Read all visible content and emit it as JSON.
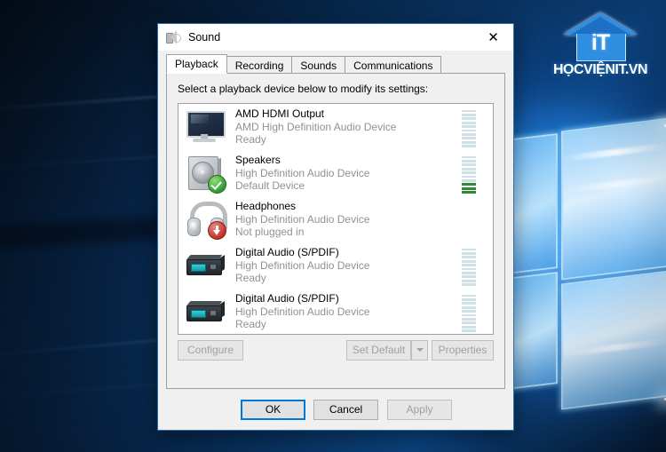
{
  "desktop": {
    "wallpaper_name": "windows-10-hero-wallpaper",
    "watermark": {
      "logo_text": "iT",
      "site_name": "HỌCVIỆNIT.VN",
      "accent": "#2f8ee0"
    }
  },
  "dialog": {
    "title": "Sound",
    "icon": "speaker-icon",
    "close_label": "✕",
    "tabs": [
      {
        "label": "Playback",
        "active": true
      },
      {
        "label": "Recording",
        "active": false
      },
      {
        "label": "Sounds",
        "active": false
      },
      {
        "label": "Communications",
        "active": false
      }
    ],
    "instruction": "Select a playback device below to modify its settings:",
    "devices": [
      {
        "name": "AMD HDMI Output",
        "driver": "AMD High Definition Audio Device",
        "status": "Ready",
        "icon": "monitor-icon",
        "badge": "none",
        "meter_segments": 10,
        "meter_lit": 0,
        "meter_visible": true
      },
      {
        "name": "Speakers",
        "driver": "High Definition Audio Device",
        "status": "Default Device",
        "icon": "speaker-icon",
        "badge": "green-check-icon",
        "meter_segments": 10,
        "meter_lit": 3,
        "meter_visible": true
      },
      {
        "name": "Headphones",
        "driver": "High Definition Audio Device",
        "status": "Not plugged in",
        "icon": "headphones-icon",
        "badge": "red-down-arrow-icon",
        "meter_segments": 10,
        "meter_lit": 0,
        "meter_visible": false
      },
      {
        "name": "Digital Audio (S/PDIF)",
        "driver": "High Definition Audio Device",
        "status": "Ready",
        "icon": "spdif-device-icon",
        "badge": "none",
        "meter_segments": 10,
        "meter_lit": 0,
        "meter_visible": true
      },
      {
        "name": "Digital Audio (S/PDIF)",
        "driver": "High Definition Audio Device",
        "status": "Ready",
        "icon": "spdif-device-icon",
        "badge": "none",
        "meter_segments": 10,
        "meter_lit": 0,
        "meter_visible": true
      }
    ],
    "mid_buttons": {
      "configure": {
        "label": "Configure",
        "enabled": false
      },
      "set_default": {
        "label": "Set Default",
        "enabled": false
      },
      "set_default_arrow": {
        "icon": "chevron-down-icon",
        "enabled": false
      },
      "properties": {
        "label": "Properties",
        "enabled": false
      }
    },
    "footer_buttons": {
      "ok": {
        "label": "OK",
        "enabled": true,
        "focused": true
      },
      "cancel": {
        "label": "Cancel",
        "enabled": true
      },
      "apply": {
        "label": "Apply",
        "enabled": false
      }
    },
    "colors": {
      "focus_blue": "#0078d7",
      "meter_lit_green": "#2e8b33",
      "meter_off": "#cfe0e8",
      "sub_text": "#919191"
    }
  }
}
